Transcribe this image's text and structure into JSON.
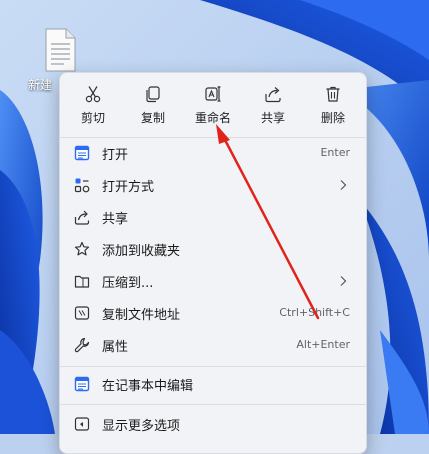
{
  "colors": {
    "accent": "#2b6cf0",
    "arrow": "#e0241b",
    "menu_bg": "#f2f3f7"
  },
  "desktop": {
    "file_icon": "text-file-icon",
    "file_label": "新建"
  },
  "quick_actions": [
    {
      "label": "剪切",
      "icon": "scissors-icon"
    },
    {
      "label": "复制",
      "icon": "copy-icon"
    },
    {
      "label": "重命名",
      "icon": "rename-icon"
    },
    {
      "label": "共享",
      "icon": "share-icon"
    },
    {
      "label": "删除",
      "icon": "trash-icon"
    }
  ],
  "menu_items": [
    {
      "label": "打开",
      "shortcut": "Enter",
      "icon": "notepad-icon"
    },
    {
      "label": "打开方式",
      "icon": "open-with-icon",
      "submenu": true
    },
    {
      "label": "共享",
      "icon": "share-icon"
    },
    {
      "label": "添加到收藏夹",
      "icon": "star-icon"
    },
    {
      "label": "压缩到...",
      "icon": "archive-icon",
      "submenu": true
    },
    {
      "label": "复制文件地址",
      "shortcut": "Ctrl+Shift+C",
      "icon": "copy-path-icon"
    },
    {
      "label": "属性",
      "shortcut": "Alt+Enter",
      "icon": "wrench-icon"
    }
  ],
  "extra_items": [
    {
      "label": "在记事本中编辑",
      "icon": "notepad-icon"
    },
    {
      "label": "显示更多选项",
      "icon": "more-options-icon"
    }
  ]
}
